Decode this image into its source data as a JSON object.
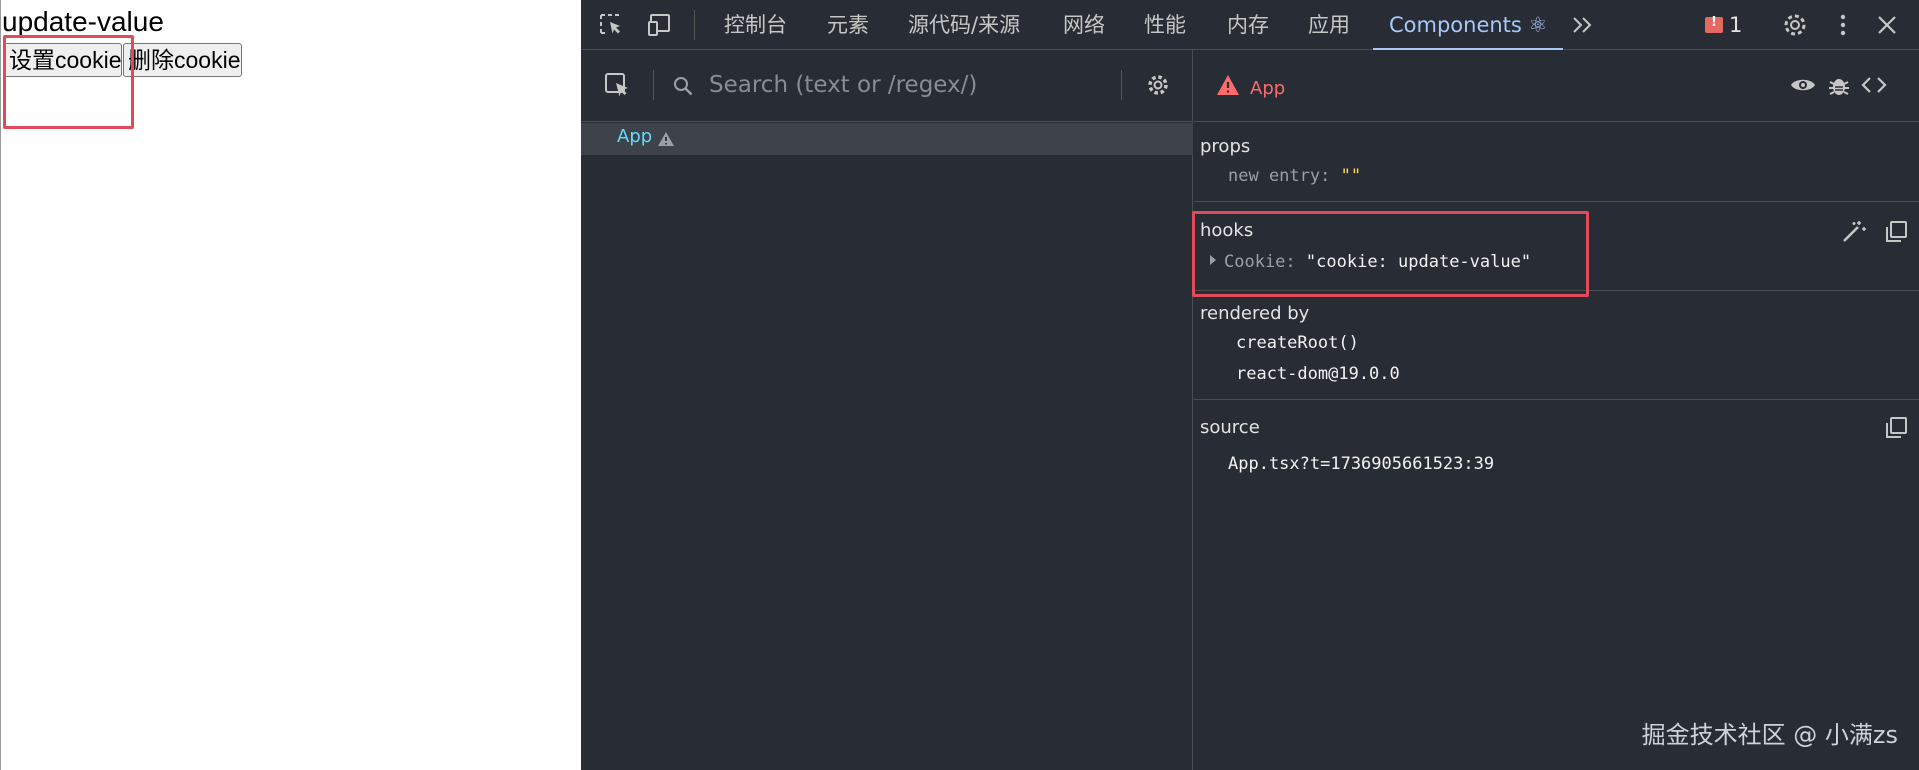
{
  "page": {
    "value_text": "update-value",
    "set_button_label": "设置cookie",
    "delete_button_label": "删除cookie"
  },
  "devtools": {
    "tabs": [
      {
        "label": "控制台"
      },
      {
        "label": "元素"
      },
      {
        "label": "源代码/来源"
      },
      {
        "label": "网络"
      },
      {
        "label": "性能"
      },
      {
        "label": "内存"
      },
      {
        "label": "应用"
      },
      {
        "label": "Components ⚛"
      }
    ],
    "active_tab": "Components ⚛",
    "error_count": "1",
    "search_placeholder": "Search (text or /regex/)",
    "tree": {
      "selected_component": "App"
    },
    "inspector": {
      "component_title": "App",
      "props": {
        "title": "props",
        "entry_key": "new entry",
        "entry_value": "\"\""
      },
      "hooks": {
        "title": "hooks",
        "entry_key": "Cookie",
        "entry_value": "\"cookie: update-value\""
      },
      "rendered_by": {
        "title": "rendered by",
        "items": [
          "createRoot()",
          "react-dom@19.0.0"
        ]
      },
      "source": {
        "title": "source",
        "value": "App.tsx?t=1736905661523:39"
      }
    },
    "watermark": "掘金技术社区 @ 小满zs",
    "colors": {
      "background": "#282c34",
      "accent": "#a8c7fa",
      "component_name": "#61dafb",
      "warning": "#ff6b6b",
      "highlight_box": "#e24a5a"
    }
  }
}
